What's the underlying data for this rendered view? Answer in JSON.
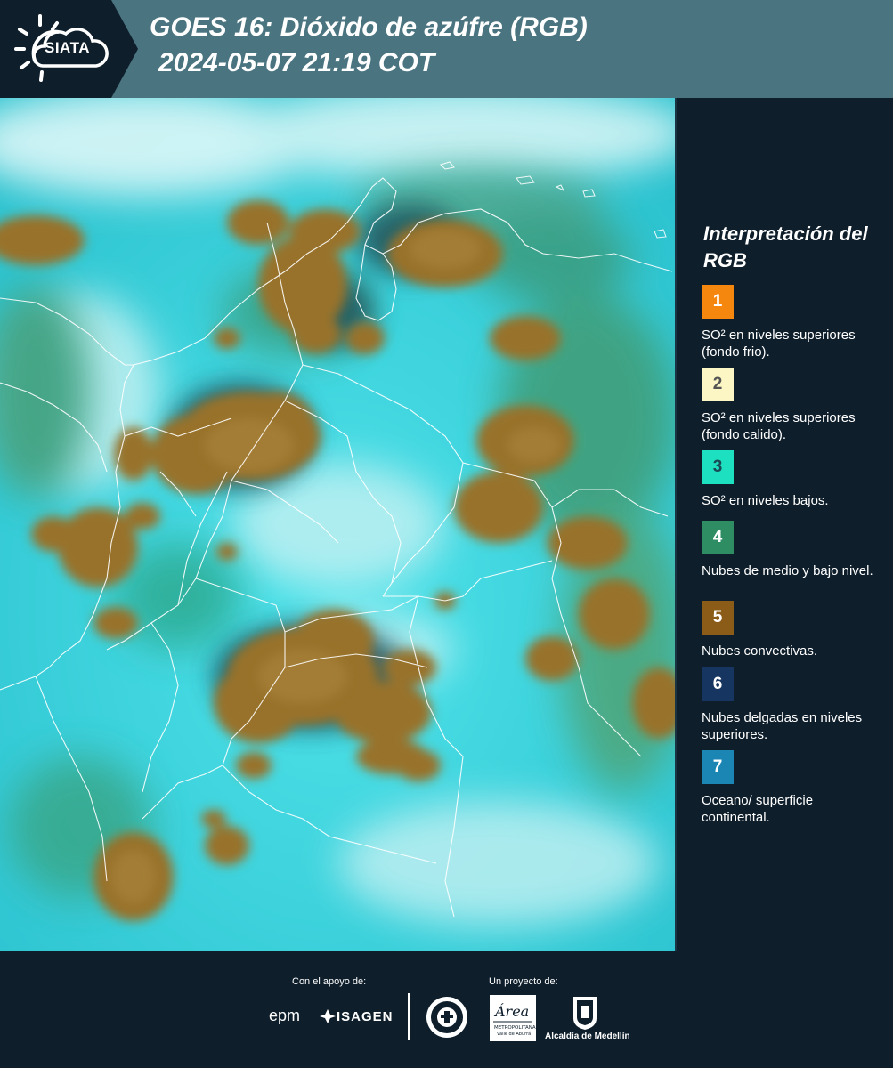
{
  "header": {
    "logo_text": "SIATA",
    "title_line1": "GOES 16: Dióxido de azúfre (RGB)",
    "title_line2": "2024-05-07 21:19 COT"
  },
  "legend": {
    "title": "Interpretación del RGB",
    "items": [
      {
        "number": "1",
        "color": "#f5870f",
        "text_color": "#ffffff",
        "description": "SO² en niveles superiores (fondo frio)."
      },
      {
        "number": "2",
        "color": "#fbf6c4",
        "text_color": "#555555",
        "description": "SO² en niveles superiores (fondo calido)."
      },
      {
        "number": "3",
        "color": "#1de0c0",
        "text_color": "#1a4a55",
        "description": "SO² en niveles bajos."
      },
      {
        "number": "4",
        "color": "#2f8d64",
        "text_color": "#ffffff",
        "description": "Nubes de medio y bajo nivel."
      },
      {
        "number": "5",
        "color": "#8a5c18",
        "text_color": "#ffffff",
        "description": "Nubes convectivas."
      },
      {
        "number": "6",
        "color": "#163560",
        "text_color": "#ffffff",
        "description": "Nubes delgadas en niveles superiores."
      },
      {
        "number": "7",
        "color": "#1b86b4",
        "text_color": "#ffffff",
        "description": "Oceano/ superficie continental."
      }
    ]
  },
  "footer": {
    "support_label": "Con el apoyo de:",
    "project_label": "Un proyecto de:",
    "sponsor1": "epm",
    "sponsor2": "ISAGEN",
    "area_label": "Área",
    "area_sub": "METROPOLITANA",
    "area_sub2": "Valle de Aburrá",
    "alcaldia_label": "Alcaldía de Medellín"
  }
}
